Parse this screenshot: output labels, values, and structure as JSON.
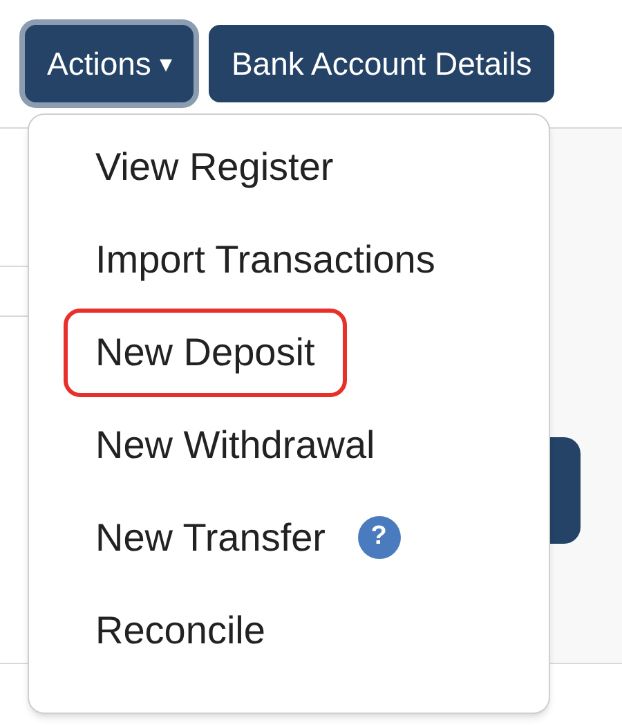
{
  "toolbar": {
    "buttons": [
      {
        "label": "Actions",
        "caret": "▾",
        "focused": true
      },
      {
        "label": "Bank Account Details",
        "focused": false
      }
    ]
  },
  "menu": {
    "items": [
      {
        "label": "View Register",
        "highlighted": false
      },
      {
        "label": "Import Transactions",
        "highlighted": false
      },
      {
        "label": "New Deposit",
        "highlighted": true
      },
      {
        "label": "New Withdrawal",
        "highlighted": false
      },
      {
        "label": "New Transfer",
        "highlighted": false,
        "help": "?"
      },
      {
        "label": "Reconcile",
        "highlighted": false
      }
    ]
  }
}
